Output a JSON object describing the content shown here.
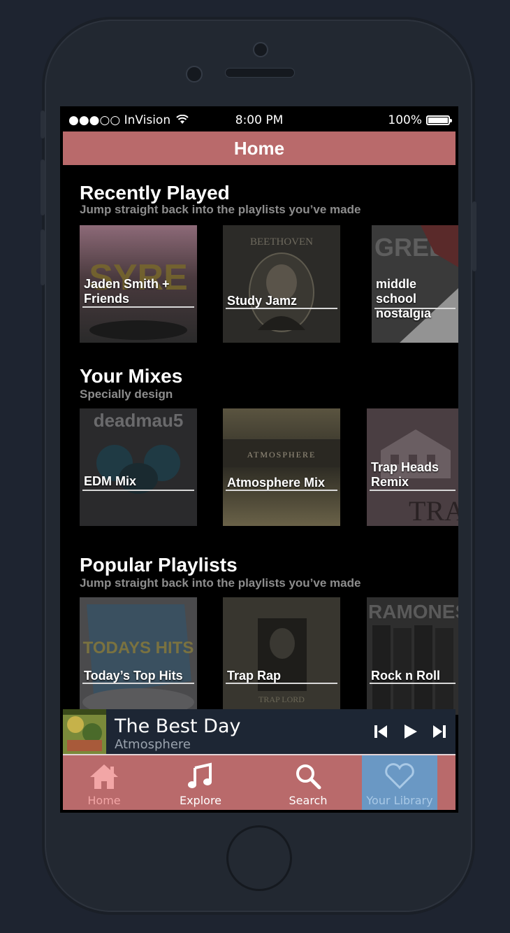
{
  "status_bar": {
    "carrier": "●●●○○ InVision",
    "time": "8:00 PM",
    "battery": "100%"
  },
  "header": {
    "title": "Home"
  },
  "sections": [
    {
      "title": "Recently Played",
      "subtitle": "Jump straight back into the playlists you’ve made",
      "items": [
        {
          "label": "Jaden Smith + Friends",
          "art_text": "SYRE"
        },
        {
          "label": "Study Jamz",
          "art_text": "BEETHOVEN"
        },
        {
          "label": "middle school nostalgia",
          "art_text": "GREEN DAY"
        }
      ]
    },
    {
      "title": "Your Mixes",
      "subtitle": "Specially design",
      "items": [
        {
          "label": "EDM Mix",
          "art_text": "deadmau5"
        },
        {
          "label": "Atmosphere Mix",
          "art_text": "ATMOSPHERE"
        },
        {
          "label": "Trap Heads Remix",
          "art_text": "TRAP"
        }
      ]
    },
    {
      "title": "Popular Playlists",
      "subtitle": "Jump straight back into the playlists you’ve made",
      "items": [
        {
          "label": "Today’s Top Hits",
          "art_text": "TODAYS HITS"
        },
        {
          "label": "Trap Rap",
          "art_text": "TRAP LORD"
        },
        {
          "label": "Rock n Roll",
          "art_text": "RAMONES"
        }
      ]
    }
  ],
  "now_playing": {
    "title": "The Best Day",
    "artist": "Atmosphere",
    "controls": [
      "previous-icon",
      "play-icon",
      "next-icon"
    ]
  },
  "tabs": [
    {
      "label": "Home",
      "icon": "home-icon",
      "color": "#f2a6a6"
    },
    {
      "label": "Explore",
      "icon": "music-note-icon",
      "color": "#ffffff"
    },
    {
      "label": "Search",
      "icon": "search-icon",
      "color": "#ffffff"
    },
    {
      "label": "Your Library",
      "icon": "heart-icon",
      "color": "#a9c9e6",
      "active_bg": "#6a98c4"
    }
  ],
  "colors": {
    "accent": "#b96a6b",
    "active_tab": "#6a98c4",
    "player_bg": "#1d2634"
  }
}
